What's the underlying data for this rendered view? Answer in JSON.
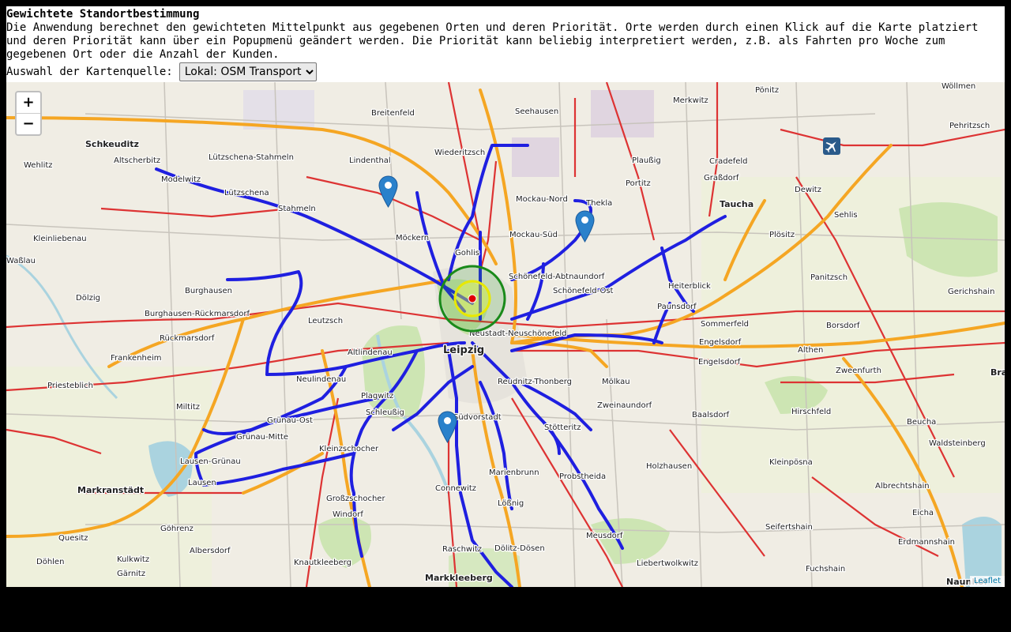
{
  "header": {
    "title": "Gewichtete Standortbestimmung",
    "description": "Die Anwendung berechnet den gewichteten Mittelpunkt aus gegebenen Orten und deren Priorität. Orte werden durch einen Klick auf die Karte platziert und deren Priorität kann über ein Popupmenü geändert werden. Die Priorität kann beliebig interpretiert werden, z.B. als Fahrten pro Woche zum gegebenen Ort oder die Anzahl der Kunden."
  },
  "map_source": {
    "label": "Auswahl der Kartenquelle:",
    "selected": "Lokal: OSM Transport"
  },
  "map": {
    "zoom_in": "+",
    "zoom_out": "−",
    "attribution": "Leaflet",
    "center_ring_colors": {
      "outer": "#1a8a1a",
      "inner": "#e8e800",
      "center": "#e00000"
    },
    "marker_color": "#2a81cb",
    "route_color": "#1f1fe0",
    "highway_color": "#f5a623",
    "road_color": "#dd3333",
    "place_labels": [
      "Breitenfeld",
      "Seehausen",
      "Merkwitz",
      "Pönitz",
      "Wöllmen",
      "Schkeuditz",
      "Altscherbitz",
      "Lützschena-Stahmeln",
      "Lindenthal",
      "Wiederitzsch",
      "Plaußig",
      "Cradefeld",
      "Pehritzsch",
      "Wehlitz",
      "Modelwitz",
      "Portitz",
      "Graßdorf",
      "Lützschena",
      "Mockau-Nord",
      "Thekla",
      "Dewitz",
      "Taucha",
      "Stahmeln",
      "Sehlis",
      "Kleinliebenau",
      "Möckern",
      "Mockau-Süd",
      "Plösitz",
      "Gohlis",
      "Schönefeld-Abtnaundorf",
      "Panitzsch",
      "Burghausen",
      "Schönefeld-Ost",
      "Heiterblick",
      "Dölzig",
      "Gerichshain",
      "Burghausen-Rückmarsdorf",
      "Leutzsch",
      "Paunsdorf",
      "Sommerfeld",
      "Borsdorf",
      "Rückmarsdorf",
      "Neustadt-Neuschönefeld",
      "Engelsdorf",
      "Altlindenau",
      "Leipzig",
      "Althen",
      "Frankenheim",
      "Engelsdorf",
      "Neulindenau",
      "Reudnitz-Thonberg",
      "Mölkau",
      "Zweenfurth",
      "Priesteblich",
      "Plagwitz",
      "Miltitz",
      "Grünau-Ost",
      "Schleußig",
      "Zweinaundorf",
      "Baalsdorf",
      "Hirschfeld",
      "Südvorstadt",
      "Stötteritz",
      "Grünau-Mitte",
      "Beucha",
      "Kleinzschocher",
      "Waldsteinberg",
      "Lausen-Grünau",
      "Lausen",
      "Holzhausen",
      "Kleinpösna",
      "Probstheida",
      "Markranstädt",
      "Marienbrunn",
      "Albrechtshain",
      "Connewitz",
      "Großzschocher",
      "Lößnig",
      "Windorf",
      "Eicha",
      "Seifertshain",
      "Göhrenz",
      "Quesitz",
      "Meusdorf",
      "Erdmannshain",
      "Albersdorf",
      "Dölitz-Dösen",
      "Raschwitz",
      "Döhlen",
      "Kulkwitz",
      "Knautkleeberg",
      "Liebertwolkwitz",
      "Fuchshain",
      "Gärnitz",
      "Markkleeberg",
      "Naunhof",
      "Brandis",
      "Waßlau"
    ]
  }
}
